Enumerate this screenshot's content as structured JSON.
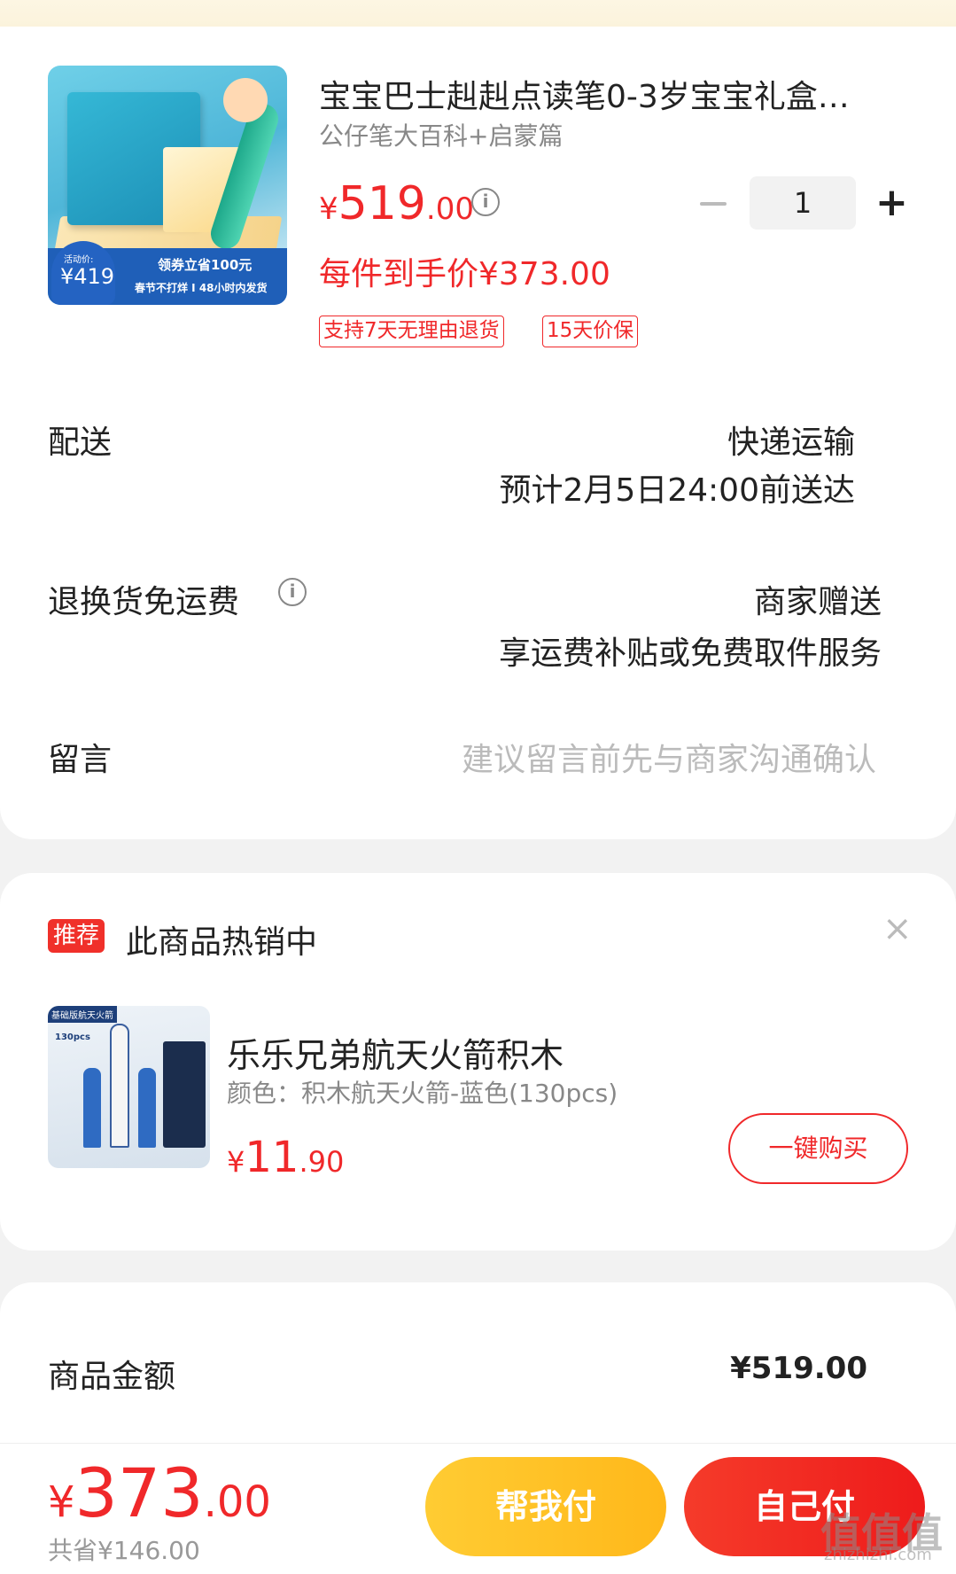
{
  "product": {
    "title": "宝宝巴士赳赳点读笔0-3岁宝宝礼盒…",
    "subtitle": "公仔笔大百科+启蒙篇",
    "price_currency": "¥",
    "price_int": "519",
    "price_dec": ".00",
    "quantity": "1",
    "minus_label": "−",
    "plus_label": "+",
    "hand_price": "每件到手价¥373.00",
    "tags": [
      "支持7天无理由退货",
      "15天价保"
    ],
    "image": {
      "badge_label": "活动价:",
      "badge_price": "¥419",
      "promo_line1": "领券立省100元",
      "promo_line2": "春节不打烊 I 48小时内发货"
    }
  },
  "delivery": {
    "label": "配送",
    "method": "快递运输",
    "eta": "预计2月5日24:00前送达"
  },
  "returns": {
    "label": "退换货免运费",
    "value": "商家赠送",
    "detail": "享运费补贴或免费取件服务"
  },
  "message": {
    "label": "留言",
    "placeholder": "建议留言前先与商家沟通确认"
  },
  "recommend": {
    "badge": "推荐",
    "title": "此商品热销中",
    "close": "×",
    "item": {
      "name": "乐乐兄弟航天火箭积木",
      "spec": "颜色：积木航天火箭-蓝色(130pcs)",
      "price_currency": "¥",
      "price_int": "11",
      "price_dec": ".90",
      "buy_label": "一键购买",
      "image_label": "基础版航天火箭",
      "image_label2": "130pcs"
    }
  },
  "amounts": {
    "goods_label": "商品金额",
    "goods_value": "¥519.00"
  },
  "footer": {
    "total_currency": "¥",
    "total_int": "373",
    "total_dec": ".00",
    "saved": "共省¥146.00",
    "help_pay": "帮我付",
    "self_pay": "自己付"
  },
  "watermark": {
    "text": "值值值",
    "url": "zhizhizhi.com"
  },
  "colors": {
    "accent_red": "#f0282a",
    "help_yellow": "#ffbf20"
  }
}
